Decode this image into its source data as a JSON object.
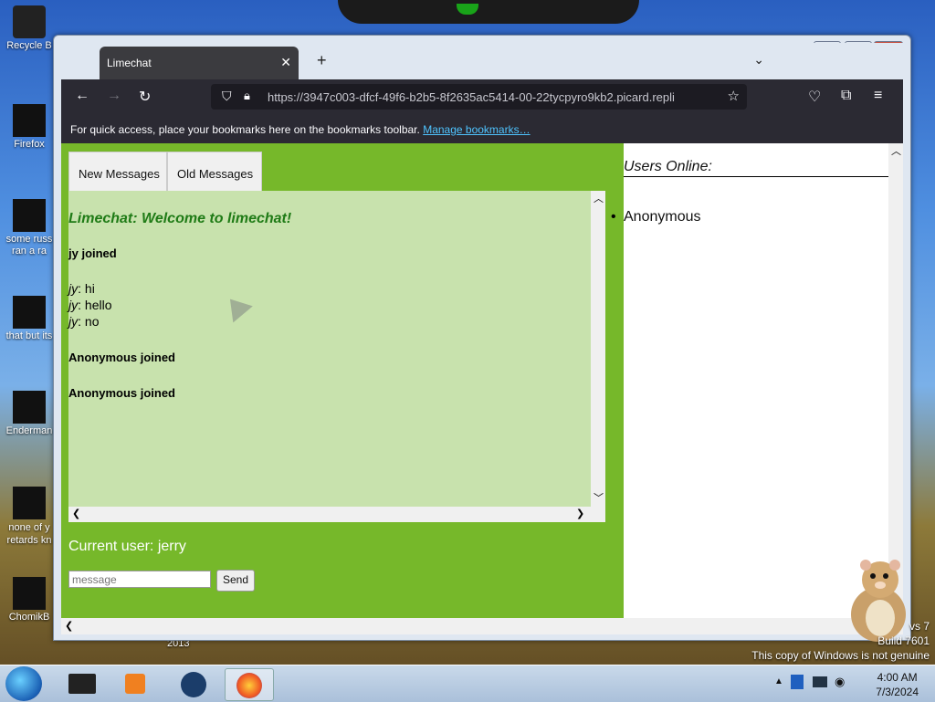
{
  "desktop": {
    "icons": [
      {
        "label": "Recycle B"
      },
      {
        "label": "Firefox"
      },
      {
        "label": "some russ ran a ra"
      },
      {
        "label": "that but its"
      },
      {
        "label": "Enderman"
      },
      {
        "label": "none of y retards kn"
      },
      {
        "label": "ChomikB"
      }
    ],
    "year_text": "2013",
    "watermark": {
      "line1": "vs 7",
      "line2": "Build 7601",
      "line3": "This copy of Windows is not genuine"
    }
  },
  "browser": {
    "tab_title": "Limechat",
    "url": "https://3947c003-dfcf-49f6-b2b5-8f2635ac5414-00-22tycpyro9kb2.picard.repli",
    "bookmarks_message": "For quick access, place your bookmarks here on the bookmarks toolbar.",
    "manage_bookmarks": "Manage bookmarks…"
  },
  "chat": {
    "tabs": [
      {
        "label": "New Messages"
      },
      {
        "label": "Old Messages"
      }
    ],
    "welcome": "Limechat: Welcome to limechat!",
    "lines": [
      {
        "type": "system",
        "text": "jy joined"
      },
      {
        "type": "msg",
        "user": "jy",
        "text": ": hi"
      },
      {
        "type": "msg",
        "user": "jy",
        "text": ": hello"
      },
      {
        "type": "msg",
        "user": "jy",
        "text": ": no"
      },
      {
        "type": "system",
        "text": "Anonymous joined"
      },
      {
        "type": "system",
        "text": "Anonymous joined"
      }
    ],
    "current_user": "Current user: jerry",
    "message_placeholder": "message",
    "send_label": "Send"
  },
  "users": {
    "title": "Users Online:",
    "list": [
      "Anonymous"
    ]
  },
  "taskbar": {
    "time": "4:00 AM",
    "date": "7/3/2024"
  },
  "colors": {
    "chat_bg": "#76b82a",
    "message_bg": "#c8e2ad",
    "welcome_text": "#1f7b16",
    "browser_chrome": "#2b2a33",
    "link": "#4fc4ff"
  }
}
